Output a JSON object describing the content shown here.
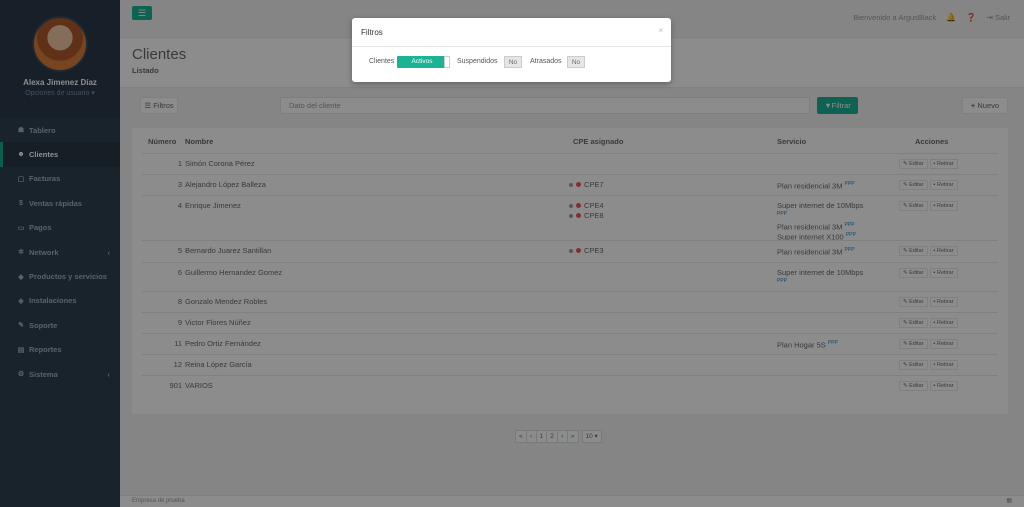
{
  "profile": {
    "name": "Alexa Jimenez Díaz",
    "options": "Opciones de usuario ▾"
  },
  "sidebar": {
    "items": [
      {
        "icon": "☗",
        "label": "Tablero"
      },
      {
        "icon": "☻",
        "label": "Clientes"
      },
      {
        "icon": "▢",
        "label": "Facturas"
      },
      {
        "icon": "$",
        "label": "Ventas rápidas"
      },
      {
        "icon": "▭",
        "label": "Pagos"
      },
      {
        "icon": "✲",
        "label": "Network"
      },
      {
        "icon": "◆",
        "label": "Productos y servicios"
      },
      {
        "icon": "◈",
        "label": "Instalaciones"
      },
      {
        "icon": "✎",
        "label": "Soporte"
      },
      {
        "icon": "▤",
        "label": "Reportes"
      },
      {
        "icon": "⚙",
        "label": "Sistema"
      }
    ]
  },
  "topbar": {
    "welcome": "Bienvenido a ArgusBlack",
    "logout": "Salir"
  },
  "heading": {
    "title": "Clientes",
    "subtitle": "Listado"
  },
  "toolbar": {
    "filters": "Filtros",
    "search_placeholder": "Dato del cliente",
    "filter_btn": "Filtrar",
    "new_btn": "Nuevo"
  },
  "table": {
    "headers": {
      "number": "Número",
      "name": "Nombre",
      "cpe": "CPE asignado",
      "service": "Servicio",
      "actions": "Acciones"
    },
    "edit_label": "Editar",
    "remove_label": "Retirar",
    "pppoe_tag": "PPP",
    "rows": [
      {
        "num": "1",
        "name": "Simón Corona Pérez",
        "cpes": [],
        "services": []
      },
      {
        "num": "3",
        "name": "Alejandro López Balleza",
        "cpes": [
          "CPE7"
        ],
        "services": [
          "Plan residencial 3M"
        ]
      },
      {
        "num": "4",
        "name": "Enrique Jimenez",
        "cpes": [
          "CPE4",
          "CPE8"
        ],
        "services": [
          "Super internet de 10Mbps",
          "Plan residencial 3M",
          "Super internet X100"
        ]
      },
      {
        "num": "5",
        "name": "Bernardo Juarez Santillan",
        "cpes": [
          "CPE3"
        ],
        "services": [
          "Plan residencial 3M"
        ]
      },
      {
        "num": "6",
        "name": "Guillermo Hernandez Gomez",
        "cpes": [],
        "services": [
          "Super internet de 10Mbps"
        ]
      },
      {
        "num": "8",
        "name": "Gonzalo Mendez Robles",
        "cpes": [],
        "services": []
      },
      {
        "num": "9",
        "name": "Victor Flores Núñez",
        "cpes": [],
        "services": []
      },
      {
        "num": "11",
        "name": "Pedro Ortiz Fernández",
        "cpes": [],
        "services": [
          "Plan Hogar 5S"
        ]
      },
      {
        "num": "12",
        "name": "Reina López García",
        "cpes": [],
        "services": []
      },
      {
        "num": "901",
        "name": "VARIOS",
        "cpes": [],
        "services": []
      }
    ]
  },
  "pagination": {
    "first": "«",
    "prev": "‹",
    "pages": [
      "1",
      "2"
    ],
    "next": "›",
    "last": "»",
    "per_page": "10 ▾"
  },
  "footer": {
    "text": "Empresa de prueba"
  },
  "modal": {
    "title": "Filtros",
    "close": "×",
    "clients_label": "Clientes",
    "clients_value": "Activos",
    "suspended_label": "Suspendidos",
    "suspended_value": "No",
    "overdue_label": "Atrasados",
    "overdue_value": "No"
  },
  "colors": {
    "accent": "#1ab394",
    "sidebar": "#2f4050",
    "danger": "#ed5565"
  }
}
